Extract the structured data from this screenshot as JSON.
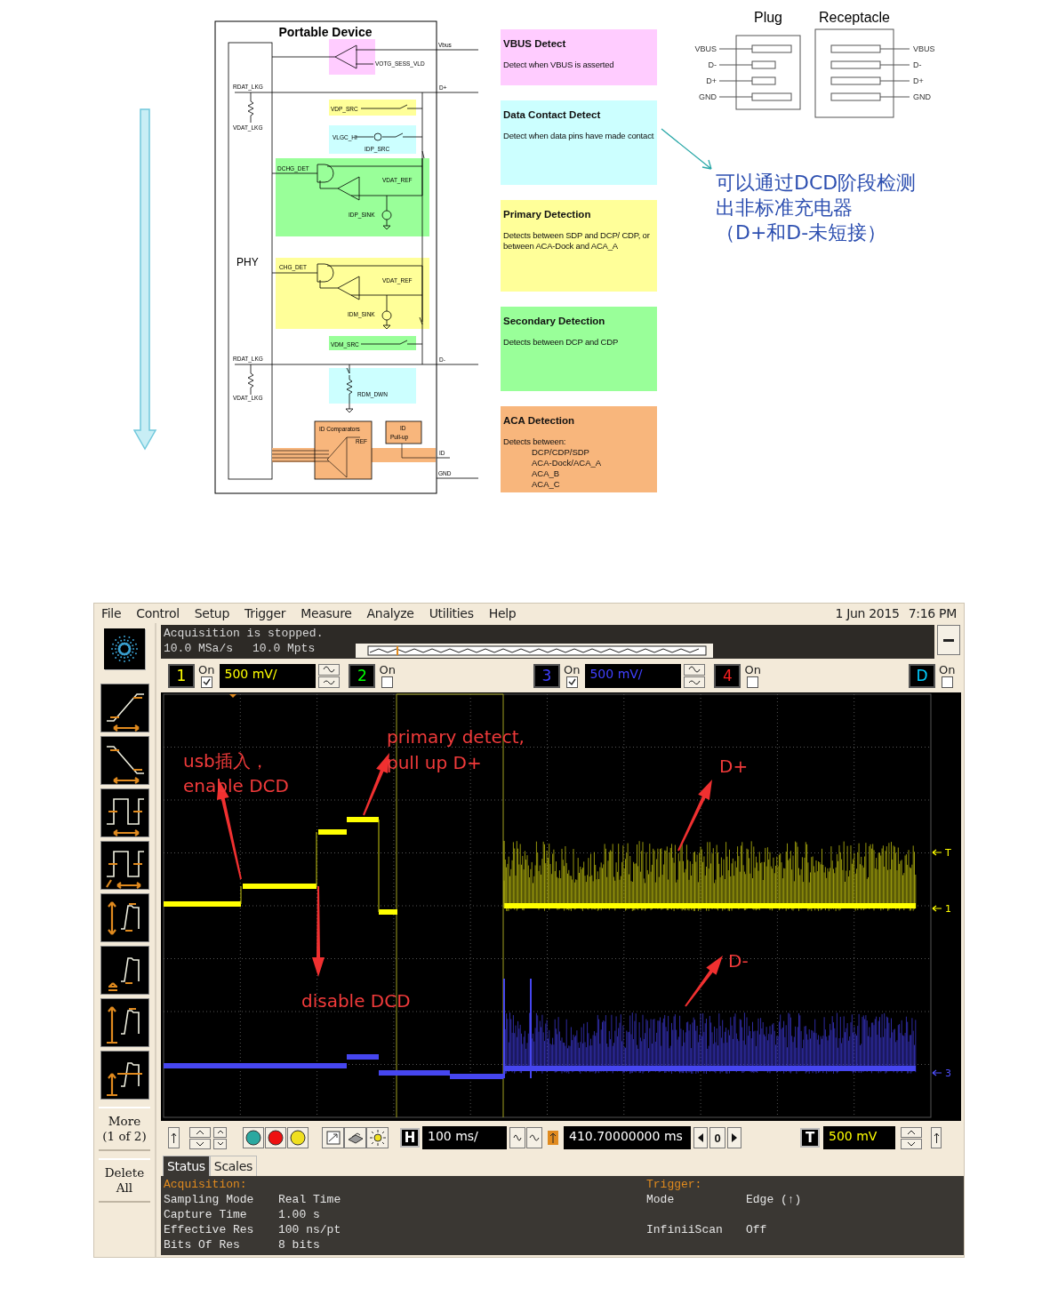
{
  "schematic": {
    "title": "Portable Device",
    "labels": [
      "Vbus",
      "VOTG_SESS_VLD",
      "RDAT_LKG",
      "D+",
      "VDAT_LKG",
      "VDP_SRC",
      "VLGC_HI",
      "IDP_SRC",
      "DCHG_DET",
      "VDAT_REF",
      "IDP_SINK",
      "PHY",
      "CHG_DET",
      "VDAT_REF",
      "IDM_SINK",
      "VDM_SRC",
      "RDAT_LKG",
      "D-",
      "VDAT_LKG",
      "RDM_DWN",
      "ID Comparators",
      "REF",
      "ID",
      "Pull-up",
      "ID",
      "GND"
    ]
  },
  "detection_steps": [
    {
      "title": "VBUS Detect",
      "description": "Detect when VBUS is asserted",
      "color": "#ffccff"
    },
    {
      "title": "Data Contact Detect",
      "description": "Detect when data pins have made contact",
      "color": "#ccffff"
    },
    {
      "title": "Primary Detection",
      "description": "Detects between SDP and DCP/ CDP, or between ACA-Dock and ACA_A",
      "color": "#ffff99"
    },
    {
      "title": "Secondary Detection",
      "description": "Detects between DCP and CDP",
      "color": "#99ff99"
    },
    {
      "title": "ACA Detection",
      "description": "Detects between:",
      "items": [
        "DCP/CDP/SDP",
        "ACA-Dock/ACA_A",
        "ACA_B",
        "ACA_C"
      ],
      "color": "#f8b67c"
    }
  ],
  "connectors": [
    {
      "title": "Plug",
      "pins": [
        "VBUS",
        "D-",
        "D+",
        "GND"
      ]
    },
    {
      "title": "Receptacle",
      "pins": [
        "VBUS",
        "D-",
        "D+",
        "GND"
      ]
    }
  ],
  "note": {
    "lines": [
      "可以通过DCD阶段检测",
      "出非标准充电器",
      "（D+和D-未短接）"
    ]
  },
  "scope": {
    "menu": [
      "File",
      "Control",
      "Setup",
      "Trigger",
      "Measure",
      "Analyze",
      "Utilities",
      "Help"
    ],
    "date": "1 Jun 2015",
    "time": "7:16 PM",
    "status": {
      "message": "Acquisition is stopped.",
      "sample_rate": "10.0 MSa/s",
      "memory_depth": "10.0 Mpts"
    },
    "channels": [
      {
        "number": "1",
        "on_label": "On",
        "checked": true,
        "scale": "500 mV/",
        "color": "#ffff00"
      },
      {
        "number": "2",
        "on_label": "On",
        "checked": false,
        "color": "#00ff00"
      },
      {
        "number": "3",
        "on_label": "On",
        "checked": true,
        "scale": "500 mV/",
        "color": "#4040ff"
      },
      {
        "number": "4",
        "on_label": "On",
        "checked": false,
        "color": "#ff2020"
      },
      {
        "number": "D",
        "on_label": "On",
        "checked": false,
        "color": "#00ccff"
      }
    ],
    "sidebar_buttons": [
      "More (1 of 2)",
      "Delete All"
    ],
    "annotations": [
      "usb插入，",
      "enable DCD",
      "primary detect,",
      "pull up D+",
      "D+",
      "disable DCD",
      "D-"
    ],
    "markers": [
      {
        "label": "T",
        "color": "#ffff00"
      },
      {
        "label": "1",
        "color": "#ffff00"
      },
      {
        "label": "3",
        "color": "#5050ff"
      }
    ],
    "horizontal": {
      "label": "H",
      "scale": "100 ms/"
    },
    "delay": {
      "value": "410.70000000 ms",
      "reference": "0"
    },
    "trigger": {
      "label": "T",
      "level": "500 mV"
    },
    "tabs": [
      {
        "label": "Status",
        "selected": true
      },
      {
        "label": "Scales",
        "selected": false
      }
    ],
    "acquisition": {
      "heading": "Acquisition:",
      "rows": [
        {
          "name": "Sampling Mode",
          "value": "Real Time"
        },
        {
          "name": "Capture Time",
          "value": "1.00 s"
        },
        {
          "name": "Effective Res",
          "value": "100 ns/pt"
        },
        {
          "name": "Bits Of Res",
          "value": "8 bits"
        }
      ]
    },
    "trigger_info": {
      "heading": "Trigger:",
      "rows": [
        {
          "name": "Mode",
          "value": "Edge (↑)"
        },
        {
          "name": "InfiniiScan",
          "value": "Off"
        }
      ]
    }
  }
}
